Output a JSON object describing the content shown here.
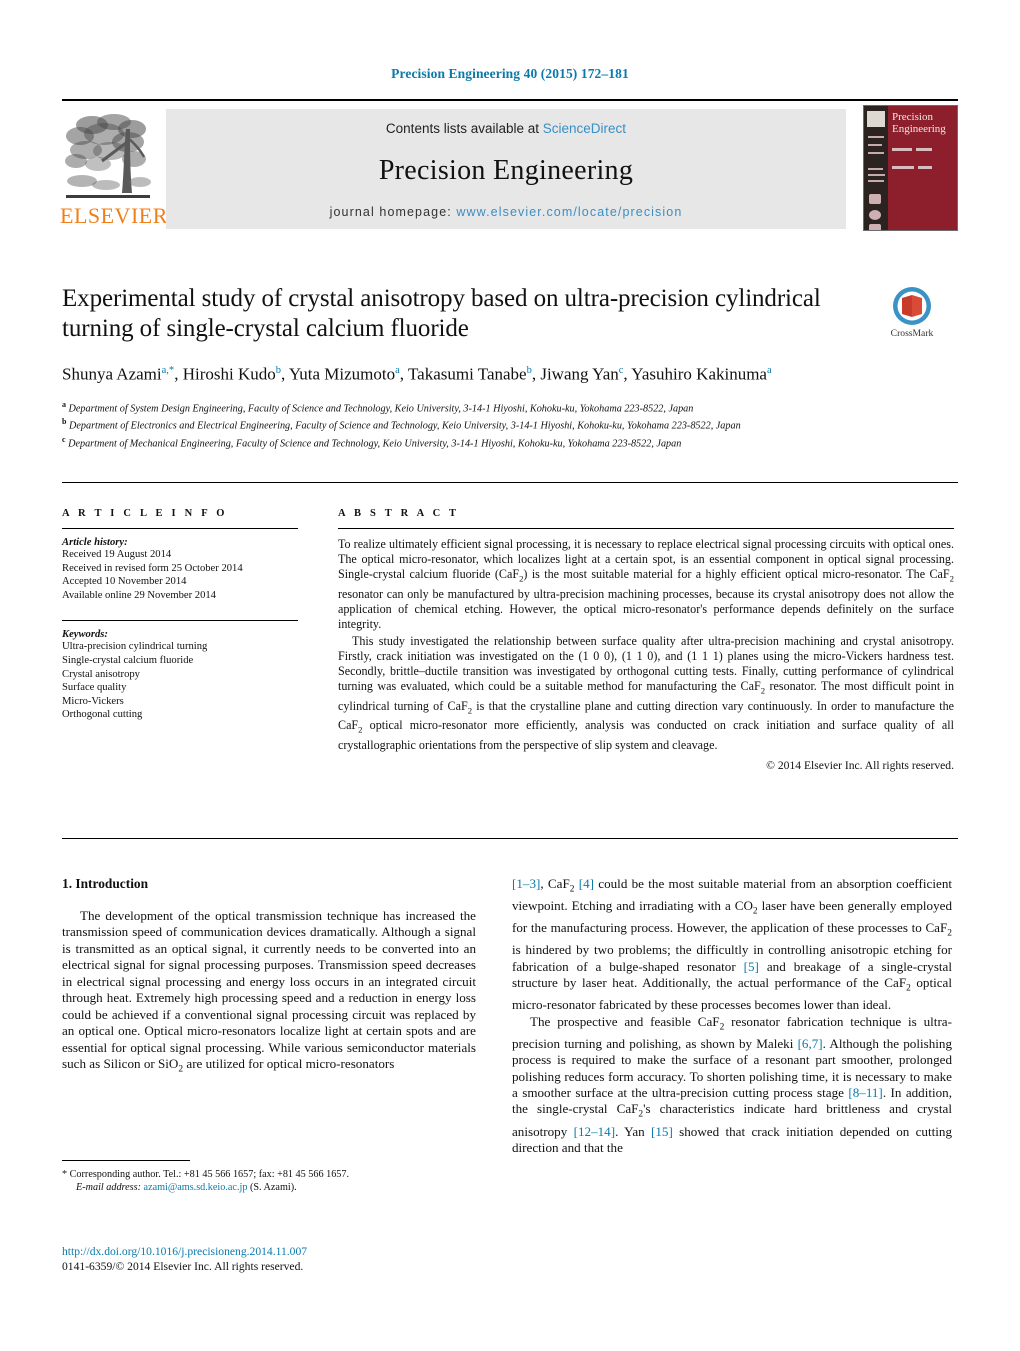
{
  "running_head": "Precision Engineering 40 (2015) 172–181",
  "masthead": {
    "contents_prefix": "Contents lists available at",
    "contents_link": "ScienceDirect",
    "journal_title": "Precision Engineering",
    "homepage_prefix": "journal homepage:",
    "homepage_url": "www.elsevier.com/locate/precision",
    "publisher_wordmark": "ELSEVIER",
    "cover_title_line1": "Precision",
    "cover_title_line2": "Engineering"
  },
  "crossmark": {
    "label": "CrossMark"
  },
  "article": {
    "title": "Experimental study of crystal anisotropy based on ultra-precision cylindrical turning of single-crystal calcium fluoride",
    "authors_html": "Shunya Azami<sup>a,*</sup>, Hiroshi Kudo<sup>b</sup>, Yuta Mizumoto<sup>a</sup>, Takasumi Tanabe<sup>b</sup>, Jiwang Yan<sup>c</sup>, Yasuhiro Kakinuma<sup>a</sup>",
    "affiliations": [
      "Department of System Design Engineering, Faculty of Science and Technology, Keio University, 3-14-1 Hiyoshi, Kohoku-ku, Yokohama 223-8522, Japan",
      "Department of Electronics and Electrical Engineering, Faculty of Science and Technology, Keio University, 3-14-1 Hiyoshi, Kohoku-ku, Yokohama 223-8522, Japan",
      "Department of Mechanical Engineering, Faculty of Science and Technology, Keio University, 3-14-1 Hiyoshi, Kohoku-ku, Yokohama 223-8522, Japan"
    ],
    "affiliation_marks": [
      "a",
      "b",
      "c"
    ]
  },
  "article_info": {
    "heading": "A R T I C L E   I N F O",
    "history_label": "Article history:",
    "history": [
      "Received 19 August 2014",
      "Received in revised form 25 October 2014",
      "Accepted 10 November 2014",
      "Available online 29 November 2014"
    ],
    "keywords_label": "Keywords:",
    "keywords": [
      "Ultra-precision cylindrical turning",
      "Single-crystal calcium fluoride",
      "Crystal anisotropy",
      "Surface quality",
      "Micro-Vickers",
      "Orthogonal cutting"
    ]
  },
  "abstract": {
    "heading": "A B S T R A C T",
    "paragraph1_html": "To realize ultimately efficient signal processing, it is necessary to replace electrical signal processing circuits with optical ones. The optical micro-resonator, which localizes light at a certain spot, is an essential component in optical signal processing. Single-crystal calcium fluoride (CaF<sub>2</sub>) is the most suitable material for a highly efficient optical micro-resonator. The CaF<sub>2</sub> resonator can only be manufactured by ultra-precision machining processes, because its crystal anisotropy does not allow the application of chemical etching. However, the optical micro-resonator's performance depends definitely on the surface integrity.",
    "paragraph2_html": "This study investigated the relationship between surface quality after ultra-precision machining and crystal anisotropy. Firstly, crack initiation was investigated on the (1 0 0), (1 1 0), and (1 1 1) planes using the micro-Vickers hardness test. Secondly, brittle–ductile transition was investigated by orthogonal cutting tests. Finally, cutting performance of cylindrical turning was evaluated, which could be a suitable method for manufacturing the CaF<sub>2</sub> resonator. The most difficult point in cylindrical turning of CaF<sub>2</sub> is that the crystalline plane and cutting direction vary continuously. In order to manufacture the CaF<sub>2</sub> optical micro-resonator more efficiently, analysis was conducted on crack initiation and surface quality of all crystallographic orientations from the perspective of slip system and cleavage.",
    "copyright": "© 2014 Elsevier Inc. All rights reserved."
  },
  "introduction": {
    "heading": "1.  Introduction",
    "left_paragraph_html": "The development of the optical transmission technique has increased the transmission speed of communication devices dramatically. Although a signal is transmitted as an optical signal, it currently needs to be converted into an electrical signal for signal processing purposes. Transmission speed decreases in electrical signal processing and energy loss occurs in an integrated circuit through heat. Extremely high processing speed and a reduction in energy loss could be achieved if a conventional signal processing circuit was replaced by an optical one. Optical micro-resonators localize light at certain spots and are essential for optical signal processing. While various semiconductor materials such as Silicon or SiO<sub>2</sub> are utilized for optical micro-resonators",
    "right_paragraph1_html": "<span class=\"ref\">[1–3]</span>, CaF<sub>2</sub> <span class=\"ref\">[4]</span> could be the most suitable material from an absorption coefficient viewpoint. Etching and irradiating with a CO<sub>2</sub> laser have been generally employed for the manufacturing process. However, the application of these processes to CaF<sub>2</sub> is hindered by two problems; the difficultly in controlling anisotropic etching for fabrication of a bulge-shaped resonator <span class=\"ref\">[5]</span> and breakage of a single-crystal structure by laser heat. Additionally, the actual performance of the CaF<sub>2</sub> optical micro-resonator fabricated by these processes becomes lower than ideal.",
    "right_paragraph2_html": "The prospective and feasible CaF<sub>2</sub> resonator fabrication technique is ultra-precision turning and polishing, as shown by Maleki <span class=\"ref\">[6,7]</span>. Although the polishing process is required to make the surface of a resonant part smoother, prolonged polishing reduces form accuracy. To shorten polishing time, it is necessary to make a smoother surface at the ultra-precision cutting process stage <span class=\"ref\">[8–11]</span>. In addition, the single-crystal CaF<sub>2</sub>'s characteristics indicate hard brittleness and crystal anisotropy <span class=\"ref\">[12–14]</span>. Yan <span class=\"ref\">[15]</span> showed that crack initiation depended on cutting direction and that the"
  },
  "footnote": {
    "corresponding_html": "*  Corresponding author. Tel.: +81 45 566 1657; fax: +81 45 566 1657.",
    "email_html": "<em>E-mail address:</em> <span class=\"fn-mail\">azami@ams.sd.keio.ac.jp</span> (S. Azami)."
  },
  "footer": {
    "doi": "http://dx.doi.org/10.1016/j.precisioneng.2014.11.007",
    "issn_line": "0141-6359/© 2014 Elsevier Inc. All rights reserved."
  },
  "colors": {
    "link": "#0b7aab",
    "masthead_link": "#3a8fc4",
    "elsevier_orange": "#f07f1a",
    "cover_red": "#8d1f2d",
    "masthead_bg": "#e7e7e7"
  }
}
